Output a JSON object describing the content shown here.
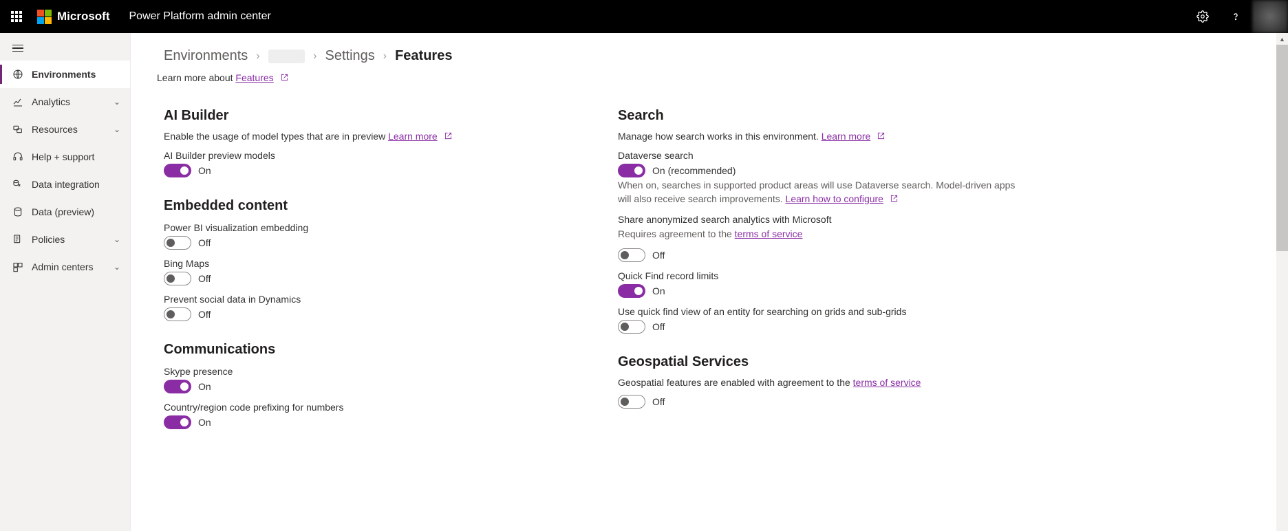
{
  "topbar": {
    "brand": "Microsoft",
    "appTitle": "Power Platform admin center"
  },
  "sidebar": {
    "items": [
      {
        "label": "Environments",
        "active": true,
        "expandable": false
      },
      {
        "label": "Analytics",
        "active": false,
        "expandable": true
      },
      {
        "label": "Resources",
        "active": false,
        "expandable": true
      },
      {
        "label": "Help + support",
        "active": false,
        "expandable": false
      },
      {
        "label": "Data integration",
        "active": false,
        "expandable": false
      },
      {
        "label": "Data (preview)",
        "active": false,
        "expandable": false
      },
      {
        "label": "Policies",
        "active": false,
        "expandable": true
      },
      {
        "label": "Admin centers",
        "active": false,
        "expandable": true
      }
    ]
  },
  "breadcrumb": {
    "root": "Environments",
    "settings": "Settings",
    "current": "Features"
  },
  "learnMoreRow": {
    "prefix": "Learn more about ",
    "link": "Features"
  },
  "labels": {
    "on": "On",
    "off": "Off",
    "onRecommended": "On (recommended)",
    "learnMore": "Learn more",
    "learnHowConfigure": "Learn how to configure",
    "termsOfService": "terms of service"
  },
  "left": {
    "aiBuilder": {
      "title": "AI Builder",
      "desc": "Enable the usage of model types that are in preview ",
      "previewModels": {
        "label": "AI Builder preview models",
        "state": "on"
      }
    },
    "embedded": {
      "title": "Embedded content",
      "powerbi": {
        "label": "Power BI visualization embedding",
        "state": "off"
      },
      "bing": {
        "label": "Bing Maps",
        "state": "off"
      },
      "social": {
        "label": "Prevent social data in Dynamics",
        "state": "off"
      }
    },
    "comms": {
      "title": "Communications",
      "skype": {
        "label": "Skype presence",
        "state": "on"
      },
      "prefix": {
        "label": "Country/region code prefixing for numbers",
        "state": "on"
      }
    }
  },
  "right": {
    "search": {
      "title": "Search",
      "desc": "Manage how search works in this environment. ",
      "dataverse": {
        "label": "Dataverse search",
        "state": "on",
        "help": "When on, searches in supported product areas will use Dataverse search. Model-driven apps will also receive search improvements. "
      },
      "shareAnalytics": {
        "label": "Share anonymized search analytics with Microsoft",
        "sub": "Requires agreement to the ",
        "state": "off"
      },
      "quickFindLimits": {
        "label": "Quick Find record limits",
        "state": "on"
      },
      "quickFindGrids": {
        "label": "Use quick find view of an entity for searching on grids and sub-grids",
        "state": "off"
      }
    },
    "geo": {
      "title": "Geospatial Services",
      "desc": "Geospatial features are enabled with agreement to the ",
      "state": "off"
    }
  }
}
